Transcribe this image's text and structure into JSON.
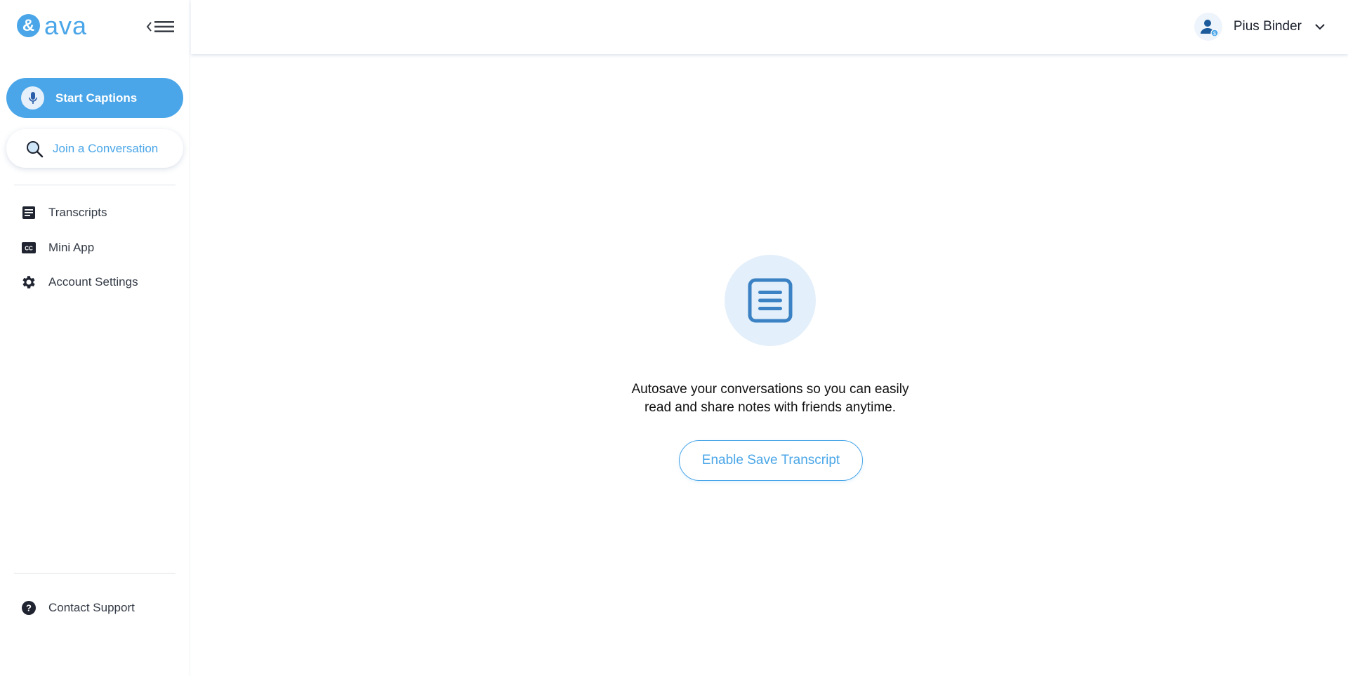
{
  "brand": {
    "mark": "&",
    "name": "ava",
    "color": "#4aa6e8"
  },
  "sidebar": {
    "start_captions": "Start Captions",
    "join_conversation": "Join a Conversation",
    "items": [
      {
        "label": "Transcripts",
        "icon": "transcript-icon"
      },
      {
        "label": "Mini App",
        "icon": "closed-caption-icon"
      },
      {
        "label": "Account Settings",
        "icon": "gear-icon"
      }
    ],
    "support": {
      "label": "Contact Support",
      "icon": "help-icon"
    }
  },
  "header": {
    "user_name": "Pius Binder"
  },
  "empty_state": {
    "line1": "Autosave your conversations so you can easily",
    "line2": "read and share notes with friends anytime.",
    "button": "Enable Save Transcript"
  }
}
